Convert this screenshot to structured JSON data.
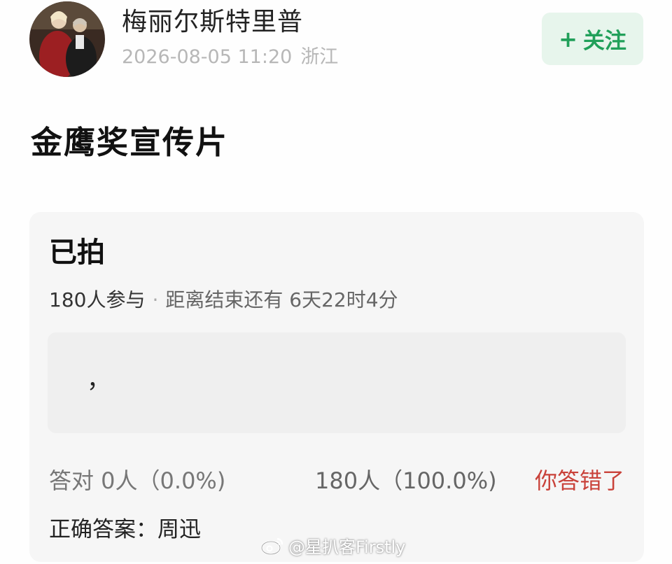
{
  "header": {
    "username": "梅丽尔斯特里普",
    "timestamp": "2026-08-05 11:20",
    "location": "浙江",
    "follow_plus": "+",
    "follow_label": "关注"
  },
  "post": {
    "title": "金鹰奖宣传片"
  },
  "quiz": {
    "question": "已拍",
    "participants": "180人参与",
    "separator": "·",
    "remaining": "距离结束还有 6天22时4分",
    "option_text": "，",
    "correct_stat": "答对 0人（0.0%)",
    "wrong_stat": "180人（100.0%)",
    "verdict": "你答错了",
    "answer": "正确答案：周迅"
  },
  "watermark": {
    "text": "@星扒客Firstly",
    "icon": "weibo-logo-icon"
  },
  "colors": {
    "follow_bg": "#e7f5ec",
    "follow_text": "#21a05a",
    "verdict": "#c9423a",
    "card_bg": "#f6f6f6"
  }
}
